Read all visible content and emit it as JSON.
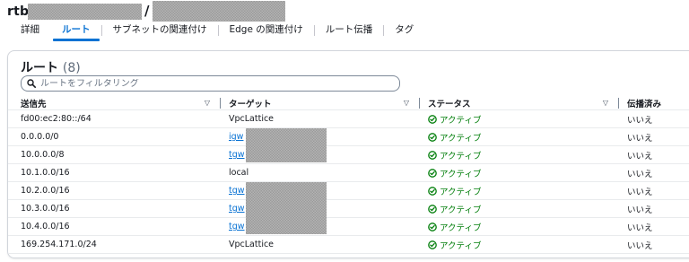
{
  "header": {
    "title_prefix": "rtb",
    "slash": "/"
  },
  "tabs": [
    {
      "label": "詳細"
    },
    {
      "label": "ルート"
    },
    {
      "label": "サブネットの関連付け"
    },
    {
      "label": "Edge の関連付け"
    },
    {
      "label": "ルート伝播"
    },
    {
      "label": "タグ"
    }
  ],
  "routes_panel": {
    "title": "ルート",
    "count": "(8)",
    "search_placeholder": "ルートをフィルタリング",
    "columns": [
      "送信先",
      "ターゲット",
      "ステータス",
      "伝播済み"
    ],
    "rows": [
      {
        "destination": "fd00:ec2:80::/64",
        "target": "VpcLattice",
        "target_is_link": false,
        "status": "アクティブ",
        "propagated": "いいえ"
      },
      {
        "destination": "0.0.0.0/0",
        "target": "igw",
        "target_is_link": true,
        "status": "アクティブ",
        "propagated": "いいえ"
      },
      {
        "destination": "10.0.0.0/8",
        "target": "tgw",
        "target_is_link": true,
        "status": "アクティブ",
        "propagated": "いいえ"
      },
      {
        "destination": "10.1.0.0/16",
        "target": "local",
        "target_is_link": false,
        "status": "アクティブ",
        "propagated": "いいえ"
      },
      {
        "destination": "10.2.0.0/16",
        "target": "tgw",
        "target_is_link": true,
        "status": "アクティブ",
        "propagated": "いいえ"
      },
      {
        "destination": "10.3.0.0/16",
        "target": "tgw",
        "target_is_link": true,
        "status": "アクティブ",
        "propagated": "いいえ"
      },
      {
        "destination": "10.4.0.0/16",
        "target": "tgw",
        "target_is_link": true,
        "status": "アクティブ",
        "propagated": "いいえ"
      },
      {
        "destination": "169.254.171.0/24",
        "target": "VpcLattice",
        "target_is_link": false,
        "status": "アクティブ",
        "propagated": "いいえ"
      }
    ]
  },
  "colors": {
    "accent": "#0972d3",
    "status_active": "#037f0c",
    "text": "#16191f"
  }
}
